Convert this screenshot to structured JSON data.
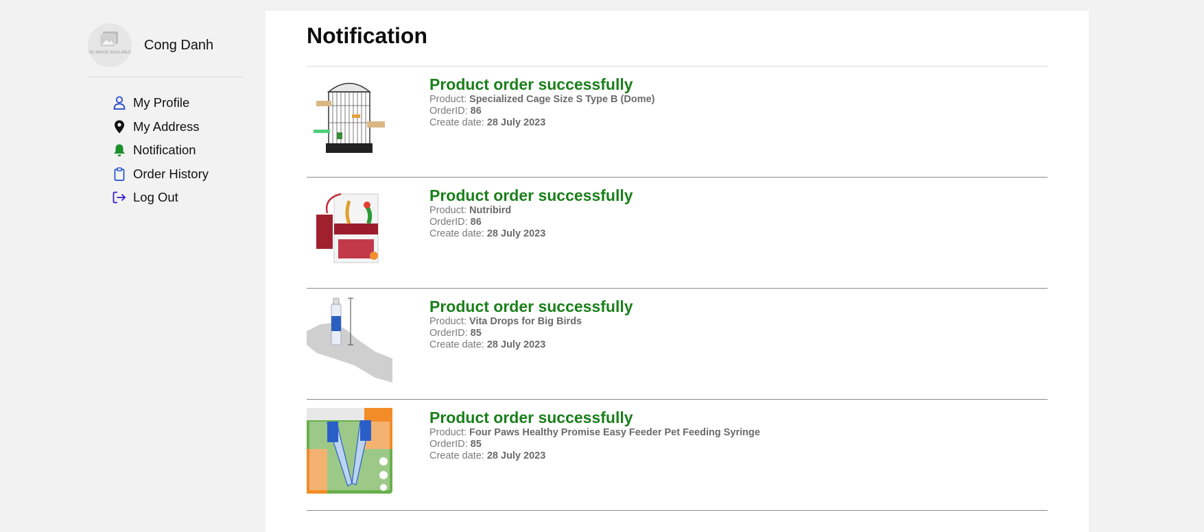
{
  "user": {
    "name": "Cong Danh",
    "avatar_caption": "NO IMAGE AVAILABLE"
  },
  "menu": [
    {
      "label": "My Profile",
      "icon": "person-icon",
      "color": "#1a3fd0"
    },
    {
      "label": "My Address",
      "icon": "location-pin-icon",
      "color": "#111111"
    },
    {
      "label": "Notification",
      "icon": "bell-icon",
      "color": "#1a8f2a"
    },
    {
      "label": "Order History",
      "icon": "clipboard-icon",
      "color": "#1a4fd0"
    },
    {
      "label": "Log Out",
      "icon": "logout-icon",
      "color": "#3a1ad0"
    }
  ],
  "page": {
    "title": "Notification"
  },
  "labels": {
    "product": "Product:",
    "order_id": "OrderID:",
    "create_date": "Create date:"
  },
  "notifications": [
    {
      "title": "Product order successfully",
      "product": "Specialized Cage Size S Type B (Dome)",
      "order_id": "86",
      "date": "28 July 2023",
      "image": "bird-cage-image"
    },
    {
      "title": "Product order successfully",
      "product": "Nutribird",
      "order_id": "86",
      "date": "28 July 2023",
      "image": "nutribird-food-bag-image"
    },
    {
      "title": "Product order successfully",
      "product": "Vita Drops for Big Birds",
      "order_id": "85",
      "date": "28 July 2023",
      "image": "vita-drops-bottle-image"
    },
    {
      "title": "Product order successfully",
      "product": "Four Paws Healthy Promise Easy Feeder Pet Feeding Syringe",
      "order_id": "85",
      "date": "28 July 2023",
      "image": "feeding-syringe-package-image"
    }
  ],
  "colors": {
    "success_green": "#1a7f1a",
    "page_bg": "#f2f2f2",
    "panel_bg": "#ffffff"
  }
}
